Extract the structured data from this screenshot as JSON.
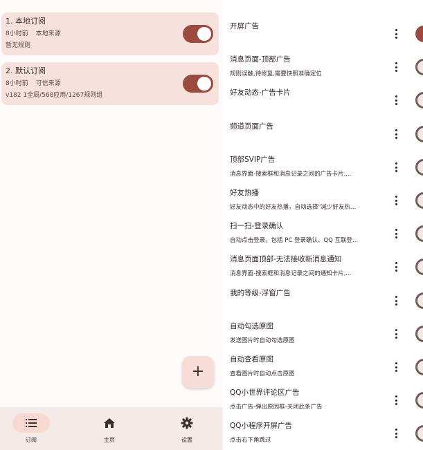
{
  "subscriptions": [
    {
      "title": "1. 本地订阅",
      "time": "8小时前",
      "source": "本地来源",
      "detail": "暂无规则",
      "enabled": true
    },
    {
      "title": "2. 默认订阅",
      "time": "8小时前",
      "source": "可信来源",
      "detail": "v182   1全局/568应用/1267规则组",
      "enabled": true
    }
  ],
  "fab": {
    "label": "+"
  },
  "bottom_nav": [
    {
      "label": "订阅",
      "icon": "list-icon",
      "active": true
    },
    {
      "label": "主页",
      "icon": "home-icon",
      "active": false
    },
    {
      "label": "设置",
      "icon": "gear-icon",
      "active": false
    }
  ],
  "rules": [
    {
      "name": "开屏广告",
      "desc": "",
      "enabled": true
    },
    {
      "name": "消息页面-顶部广告",
      "desc": "规则误触,待修复,需要快照准确定位",
      "enabled": false
    },
    {
      "name": "好友动态-广告卡片",
      "desc": "",
      "enabled": false
    },
    {
      "name": "频道页面广告",
      "desc": "",
      "enabled": false
    },
    {
      "name": "顶部SVIP广告",
      "desc": "消息界面-搜索框和消息记录之间的广告卡片,...",
      "enabled": false
    },
    {
      "name": "好友热播",
      "desc": "好友动态中的好友热播，自动选择\"减少好友热...",
      "enabled": false
    },
    {
      "name": "扫一扫-登录确认",
      "desc": "自动点击登录，包括 PC 登录确认、QQ 互联登...",
      "enabled": false
    },
    {
      "name": "消息页面顶部-无法接收新消息通知",
      "desc": "消息界面-搜索框和消息记录之间的通知卡片,...",
      "enabled": false
    },
    {
      "name": "我的等级-浮窗广告",
      "desc": "",
      "enabled": false
    },
    {
      "name": "自动勾选原图",
      "desc": "发送图片时自动勾选原图",
      "enabled": false
    },
    {
      "name": "自动查看原图",
      "desc": "查看图片时自动点击原图",
      "enabled": false
    },
    {
      "name": "QQ小世界评论区广告",
      "desc": "点击广告-弹出原因框-关闭此条广告",
      "enabled": false
    },
    {
      "name": "QQ小程序开屏广告",
      "desc": "点击右下角跳过",
      "enabled": false
    }
  ],
  "colors": {
    "accent": "#9a4a3e",
    "card": "#f7e1dc",
    "nav_bg": "#f4ebe9"
  }
}
